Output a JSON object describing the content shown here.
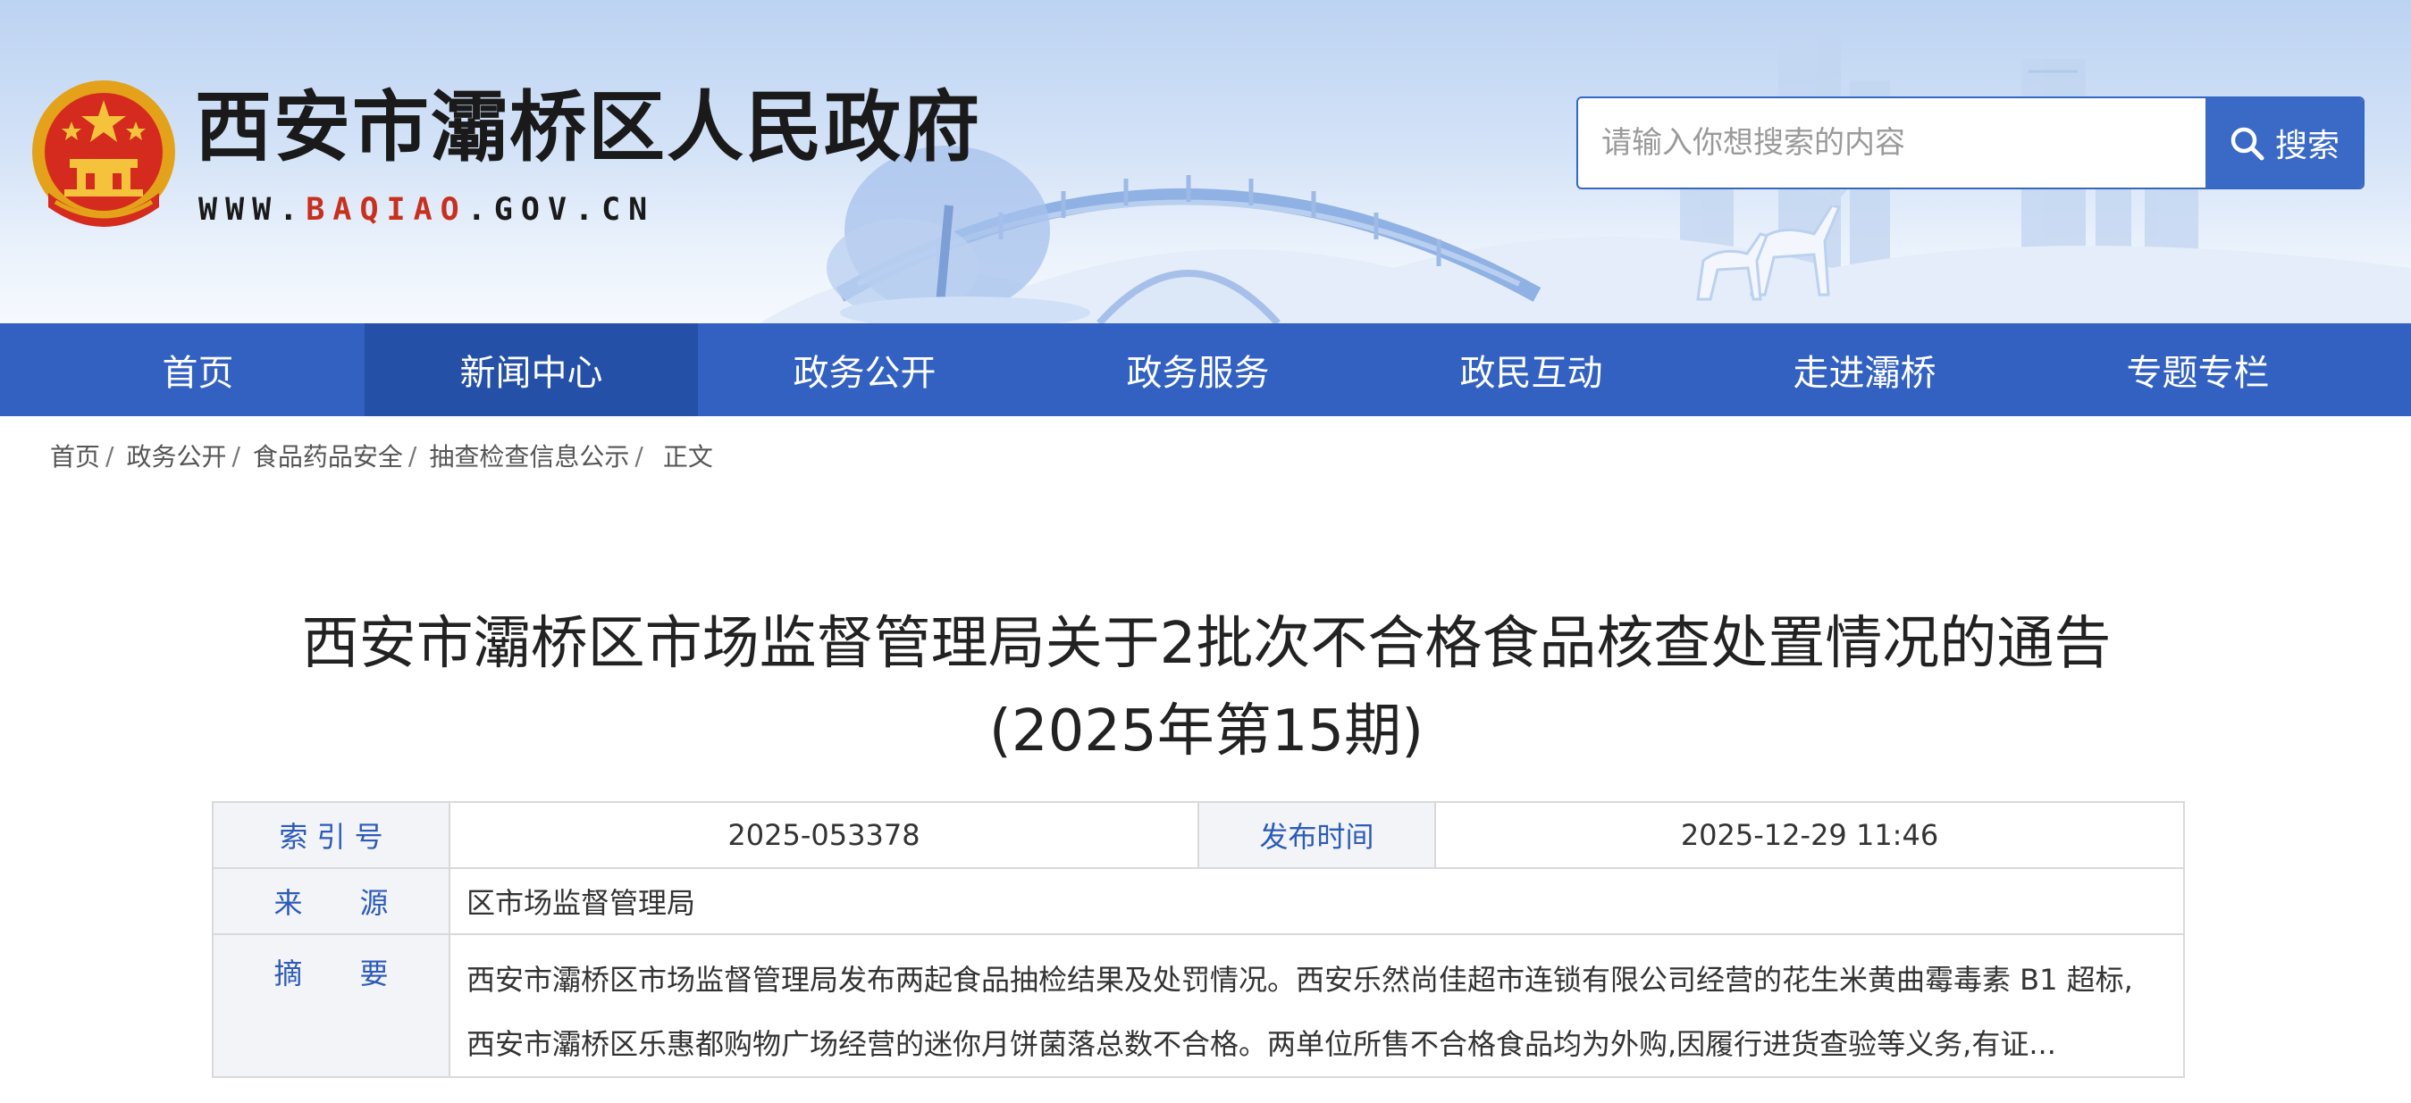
{
  "site": {
    "name": "西安市灞桥区人民政府",
    "url_prefix": "WWW.",
    "url_accent": "BAQIAO",
    "url_suffix": ".GOV.CN"
  },
  "search": {
    "placeholder": "请输入你想搜索的内容",
    "button_label": "搜索"
  },
  "nav": {
    "items": [
      "首页",
      "新闻中心",
      "政务公开",
      "政务服务",
      "政民互动",
      "走进灞桥",
      "专题专栏"
    ],
    "active": "新闻中心"
  },
  "breadcrumb": {
    "items": [
      "首页",
      "政务公开",
      "食品药品安全",
      "抽查检查信息公示"
    ],
    "separator": "/",
    "current": "正文"
  },
  "article": {
    "title_line1": "西安市灞桥区市场监督管理局关于2批次不合格食品核查处置情况的通告",
    "title_line2": "(2025年第15期)"
  },
  "meta": {
    "index_label": "索 引 号",
    "index_value": "2025-053378",
    "publish_label": "发布时间",
    "publish_value": "2025-12-29 11:46",
    "source_label": "来　　源",
    "source_value": "区市场监督管理局",
    "summary_label": "摘　　要",
    "summary_line1": "西安市灞桥区市场监督管理局发布两起食品抽检结果及处罚情况。西安乐然尚佳超市连锁有限公司经营的花生米黄曲霉毒素 B1 超标,",
    "summary_line2": "西安市灞桥区乐惠都购物广场经营的迷你月饼菌落总数不合格。两单位所售不合格食品均为外购,因履行进货查验等义务,有证..."
  },
  "colors": {
    "nav_bg": "#3261c1",
    "nav_active": "#2550a8",
    "accent_red": "#c7301f",
    "label_blue": "#2d5bb8"
  },
  "icons": {
    "emblem": "national-emblem-icon",
    "search": "search-icon"
  }
}
